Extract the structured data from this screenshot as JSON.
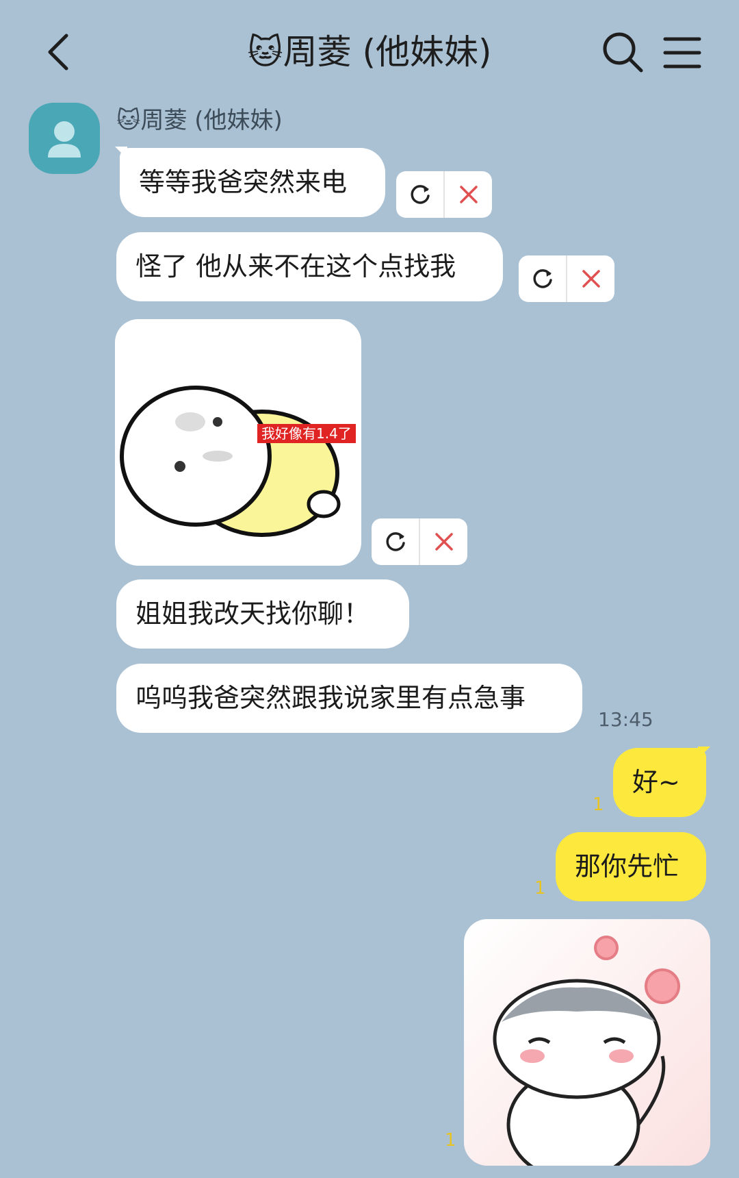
{
  "header": {
    "title": "🐱周菱 (他妹妹)"
  },
  "sender": {
    "name": "🐱周菱 (他妹妹)"
  },
  "messages": {
    "m1": "等等我爸突然来电",
    "m2": "怪了 他从来不在这个点找我",
    "m3_sticker_caption": "我好像有1.4了",
    "m4": "姐姐我改天找你聊！",
    "m5": "呜呜我爸突然跟我说家里有点急事",
    "time": "13:45",
    "r1": "好~",
    "r2": "那你先忙",
    "read1": "1",
    "read2": "1",
    "read3": "1"
  },
  "colors": {
    "background": "#aac0d3",
    "my_bubble": "#fde93d",
    "their_bubble": "#ffffff",
    "avatar": "#4aa7b5",
    "cancel": "#e05050"
  }
}
